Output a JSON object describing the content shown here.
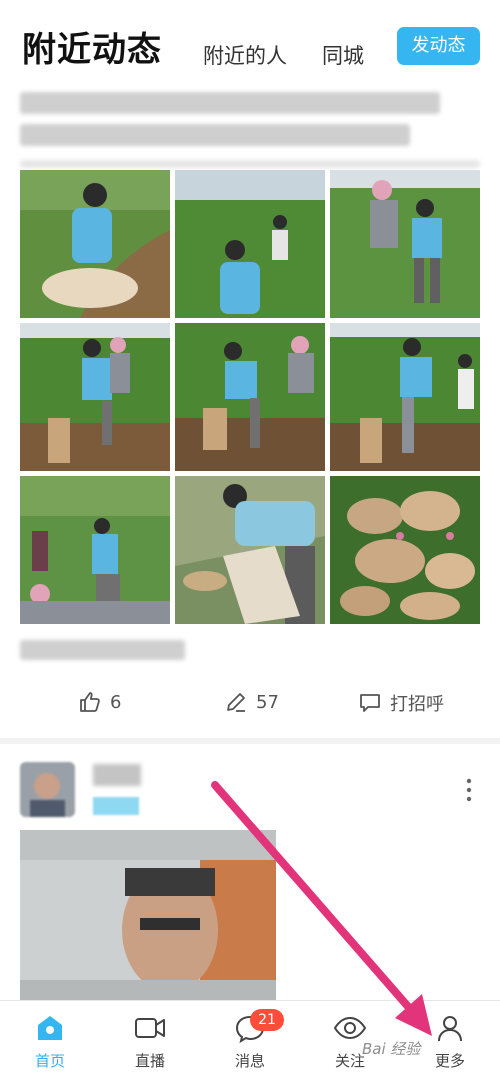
{
  "header": {
    "title": "附近动态",
    "tabs": [
      "附近的人",
      "同城"
    ],
    "post_button": "发动态"
  },
  "post": {
    "likes": "6",
    "comments": "57",
    "greet_label": "打招呼"
  },
  "nav": {
    "items": [
      {
        "label": "首页",
        "icon": "home-icon"
      },
      {
        "label": "直播",
        "icon": "video-icon"
      },
      {
        "label": "消息",
        "icon": "message-icon",
        "badge": "21"
      },
      {
        "label": "关注",
        "icon": "eye-icon"
      },
      {
        "label": "更多",
        "icon": "person-icon"
      }
    ]
  },
  "watermark": "Bai 经验",
  "colors": {
    "accent": "#35b6f0",
    "badge": "#ff4d3a",
    "arrow": "#e2347a"
  }
}
